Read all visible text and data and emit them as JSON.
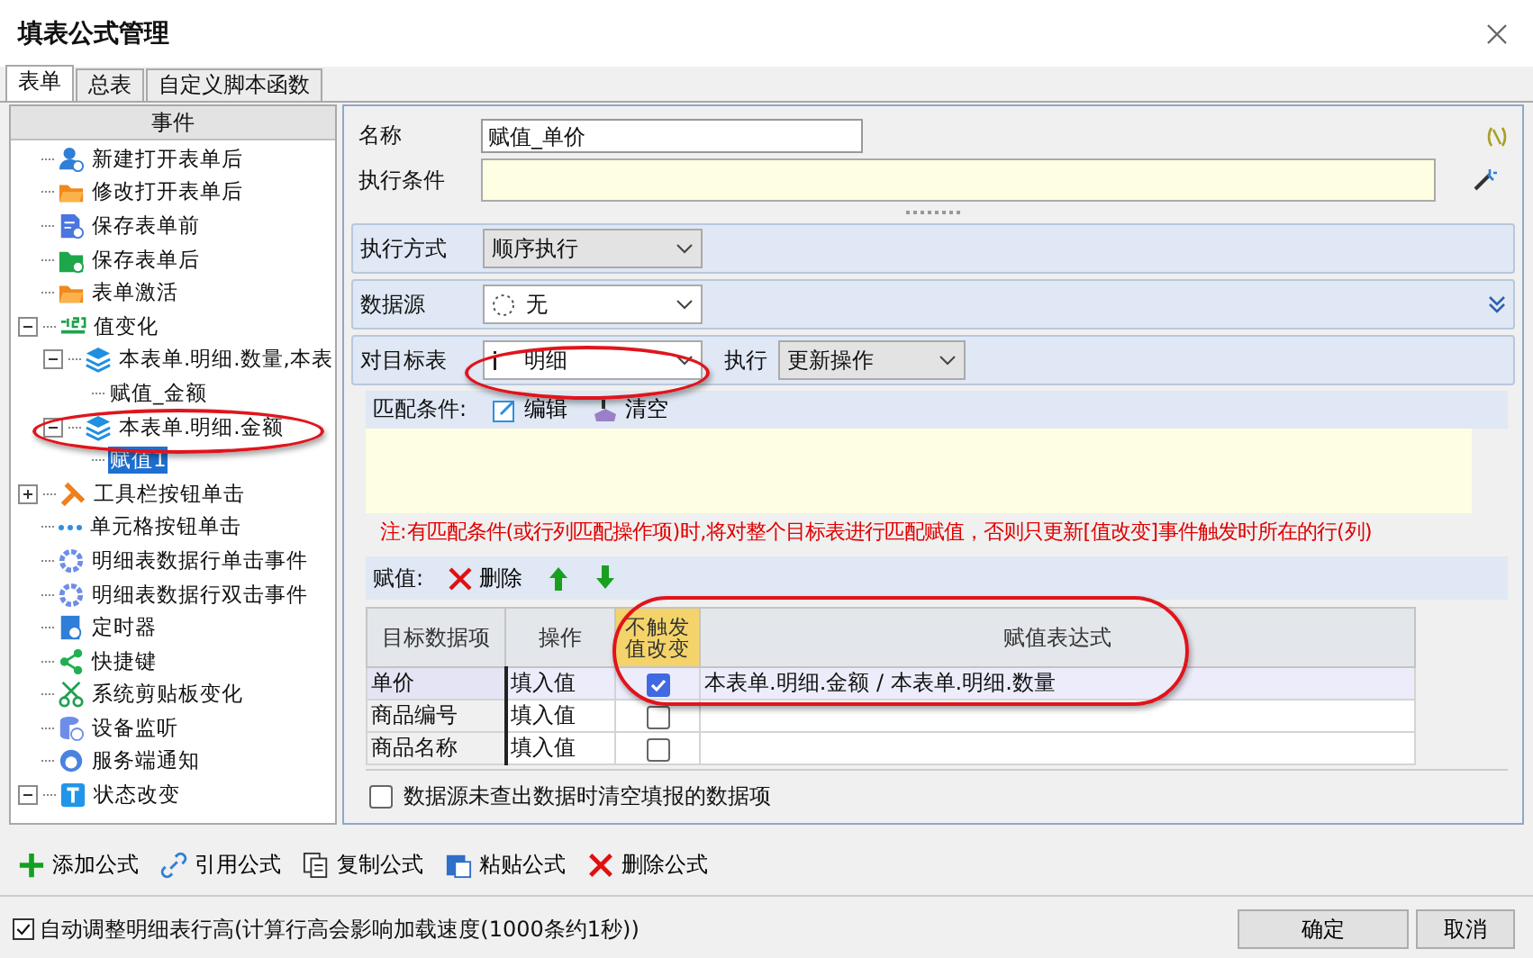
{
  "window": {
    "title": "填表公式管理"
  },
  "tabs": [
    {
      "label": "表单",
      "selected": true
    },
    {
      "label": "总表",
      "selected": false
    },
    {
      "label": "自定义脚本函数",
      "selected": false
    }
  ],
  "events": {
    "header": "事件",
    "tree": [
      {
        "label": "新建打开表单后",
        "selected": false
      },
      {
        "label": "修改打开表单后",
        "selected": false
      },
      {
        "label": "保存表单前",
        "selected": false
      },
      {
        "label": "保存表单后",
        "selected": false
      },
      {
        "label": "表单激活",
        "selected": false
      },
      {
        "label": "值变化",
        "selected": false,
        "expanded": true,
        "children": [
          {
            "label": "本表单.明细.数量,本表",
            "selected": false,
            "expanded": true,
            "children": [
              {
                "label": "赋值_金额",
                "selected": false
              }
            ]
          },
          {
            "label": "本表单.明细.金额",
            "selected": false,
            "expanded": true,
            "children": [
              {
                "label": "赋值1",
                "selected": true
              }
            ]
          }
        ]
      },
      {
        "label": "工具栏按钮单击",
        "selected": false,
        "expanded": false
      },
      {
        "label": "单元格按钮单击",
        "selected": false
      },
      {
        "label": "明细表数据行单击事件",
        "selected": false
      },
      {
        "label": "明细表数据行双击事件",
        "selected": false
      },
      {
        "label": "定时器",
        "selected": false
      },
      {
        "label": "快捷键",
        "selected": false
      },
      {
        "label": "系统剪贴板变化",
        "selected": false
      },
      {
        "label": "设备监听",
        "selected": false
      },
      {
        "label": "服务端通知",
        "selected": false
      },
      {
        "label": "状态改变",
        "selected": false,
        "expanded": true
      }
    ]
  },
  "formula": {
    "name_label": "名称",
    "name_value": "赋值_单价",
    "condition_label": "执行条件",
    "exec_mode": {
      "label": "执行方式",
      "value": "顺序执行"
    },
    "data_source": {
      "label": "数据源",
      "value": "无"
    },
    "target": {
      "label": "对目标表",
      "value": "明细",
      "exec_label": "执行",
      "exec_value": "更新操作"
    }
  },
  "match": {
    "label": "匹配条件:",
    "edit": "编辑",
    "clear": "清空",
    "note": "注:有匹配条件(或行列匹配操作项)时,将对整个目标表进行匹配赋值，否则只更新[值改变]事件触发时所在的行(列)"
  },
  "assign": {
    "label": "赋值:",
    "delete": "删除",
    "columns": [
      "目标数据项",
      "操作",
      "不触发值改变",
      "赋值表达式"
    ],
    "rows": [
      {
        "target": "单价",
        "op": "填入值",
        "no_trigger": true,
        "expression": "本表单.明细.金额 / 本表单.明细.数量",
        "selected": true
      },
      {
        "target": "商品编号",
        "op": "填入值",
        "no_trigger": false,
        "expression": "",
        "selected": false
      },
      {
        "target": "商品名称",
        "op": "填入值",
        "no_trigger": false,
        "expression": "",
        "selected": false
      }
    ]
  },
  "clear_option": {
    "label": "数据源未查出数据时清空填报的数据项",
    "checked": false
  },
  "toolbar": [
    "添加公式",
    "引用公式",
    "复制公式",
    "粘贴公式",
    "删除公式"
  ],
  "auto_height": {
    "label": "自动调整明细表行高(计算行高会影响加载速度(1000条约1秒))",
    "checked": true
  },
  "buttons": [
    "确定",
    "取消"
  ]
}
